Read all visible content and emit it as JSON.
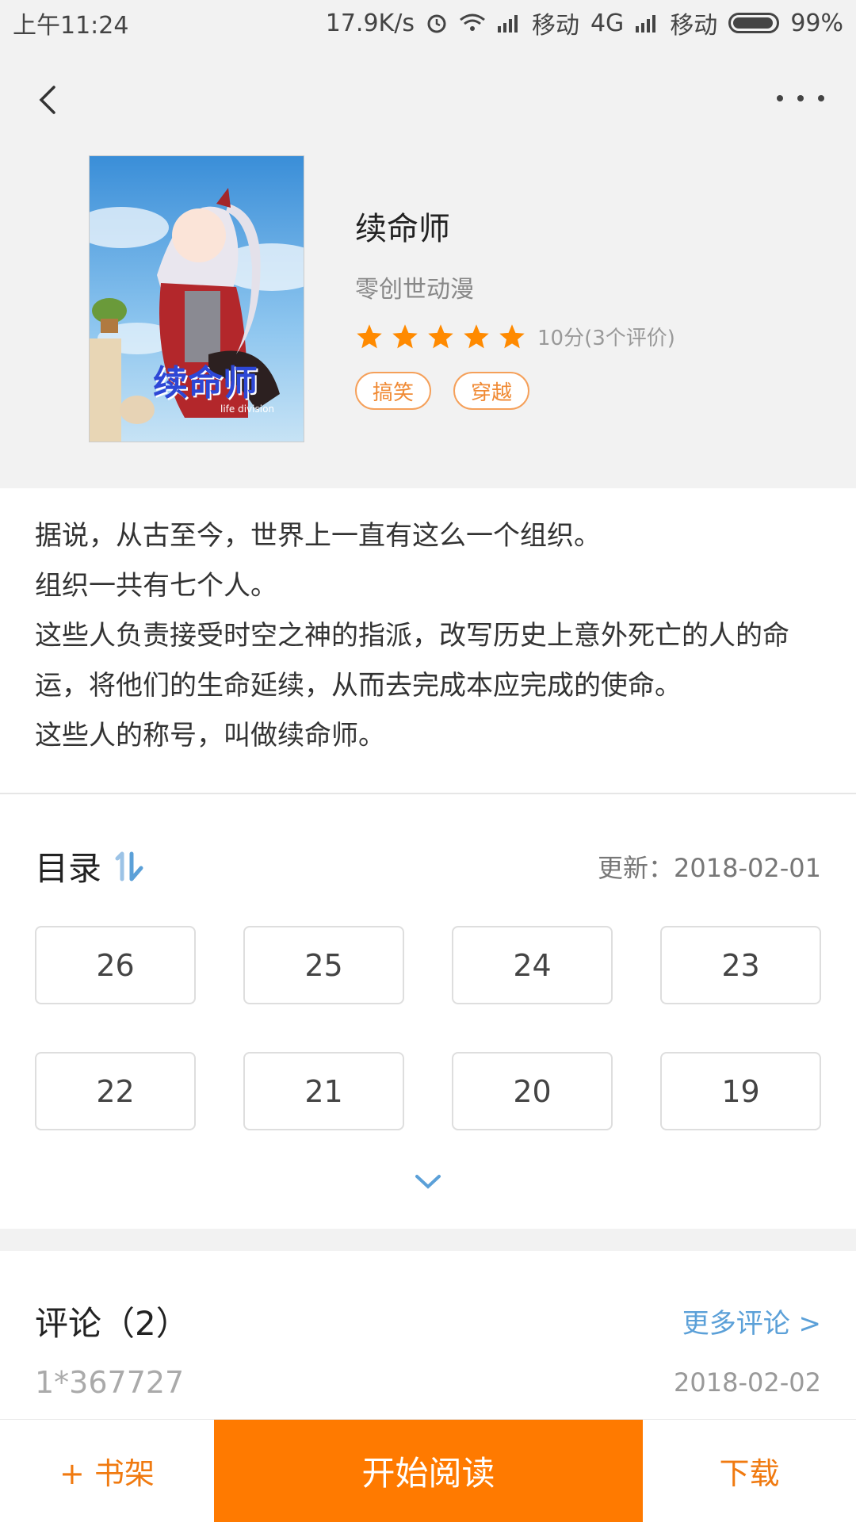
{
  "status_bar": {
    "time": "上午11:24",
    "net_speed": "17.9K/s",
    "carrier1": "移动",
    "network_type": "4G",
    "carrier2": "移动",
    "battery": "99%"
  },
  "book": {
    "title": "续命师",
    "author": "零创世动漫",
    "rating_stars": 5,
    "rating_text": "10分(3个评价)",
    "tags": [
      "搞笑",
      "穿越"
    ],
    "cover_title": "续命师",
    "cover_subtitle": "life division"
  },
  "description": [
    "据说，从古至今，世界上一直有这么一个组织。",
    "组织一共有七个人。",
    "这些人负责接受时空之神的指派，改写历史上意外死亡的人的命运，将他们的生命延续，从而去完成本应完成的使命。",
    "这些人的称号，叫做续命师。"
  ],
  "catalog": {
    "title": "目录",
    "update": "更新：2018-02-01",
    "chapters": [
      "26",
      "25",
      "24",
      "23",
      "22",
      "21",
      "20",
      "19"
    ]
  },
  "comments": {
    "title": "评论（2）",
    "more": "更多评论 >",
    "first_user": "1*367727",
    "first_date": "2018-02-02"
  },
  "bottom_bar": {
    "shelf": "+ 书架",
    "read": "开始阅读",
    "download": "下载"
  },
  "colors": {
    "accent": "#ff7a00",
    "star": "#ff8a00",
    "link": "#5ba0d8"
  }
}
